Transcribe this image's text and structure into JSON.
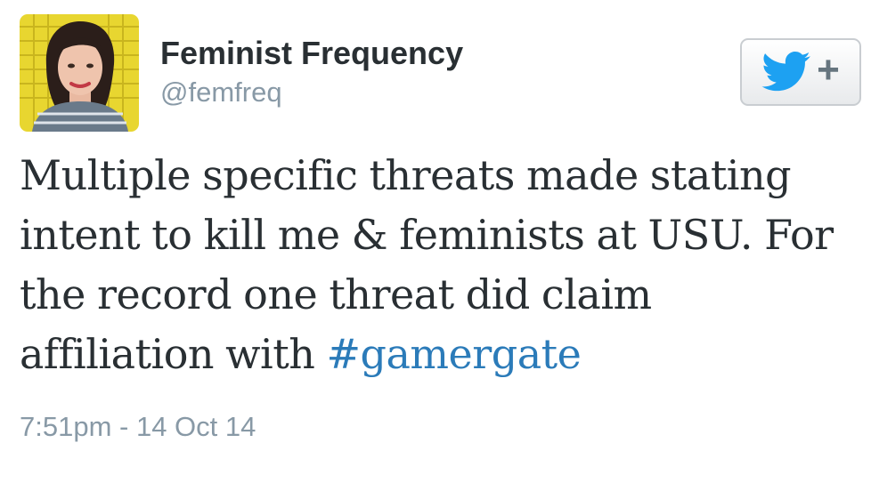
{
  "user": {
    "display_name": "Feminist Frequency",
    "handle": "@femfreq"
  },
  "follow_button": {
    "icon": "twitter-bird-icon",
    "plus_label": "+"
  },
  "tweet": {
    "lines": [
      "Multiple specific threats made stating",
      "intent to kill me & feminists at USU. For",
      "the record one threat did claim",
      "affiliation with "
    ],
    "hashtag": "#gamergate",
    "timestamp": "7:51pm - 14 Oct 14"
  },
  "colors": {
    "text": "#292f33",
    "secondary": "#8899a6",
    "link": "#2b7bb9",
    "brand_bird": "#1da1f2"
  }
}
